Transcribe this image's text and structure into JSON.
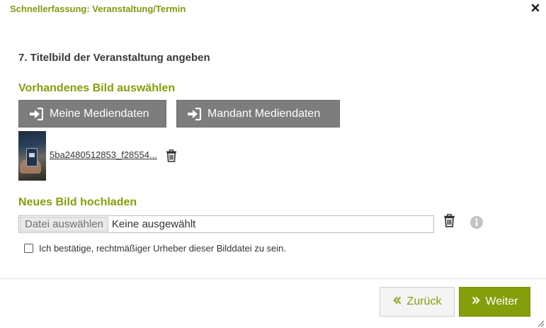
{
  "dialog": {
    "title": "Schnellerfassung: Veranstaltung/Termin",
    "close_icon": "close-icon"
  },
  "step": {
    "title": "7. Titelbild der Veranstaltung angeben"
  },
  "existing_image": {
    "heading": "Vorhandenes Bild auswählen",
    "buttons": [
      {
        "label": "Meine Mediendaten",
        "icon": "sign-in-icon"
      },
      {
        "label": "Mandant Mediendaten",
        "icon": "sign-in-icon"
      }
    ],
    "selected_file": {
      "filename": "5ba2480512853_f28554...",
      "delete_icon": "trash-icon"
    }
  },
  "upload": {
    "heading": "Neues Bild hochladen",
    "choose_label": "Datei auswählen",
    "status": "Keine ausgewählt",
    "delete_icon": "trash-icon",
    "info_icon": "info-icon",
    "confirm_label": "Ich bestätige, rechtmäßiger Urheber dieser Bilddatei zu sein.",
    "confirm_checked": false
  },
  "footer": {
    "back_label": "Zurück",
    "next_label": "Weiter"
  },
  "colors": {
    "accent": "#849f0b",
    "button_gray": "#7d7d7d"
  }
}
